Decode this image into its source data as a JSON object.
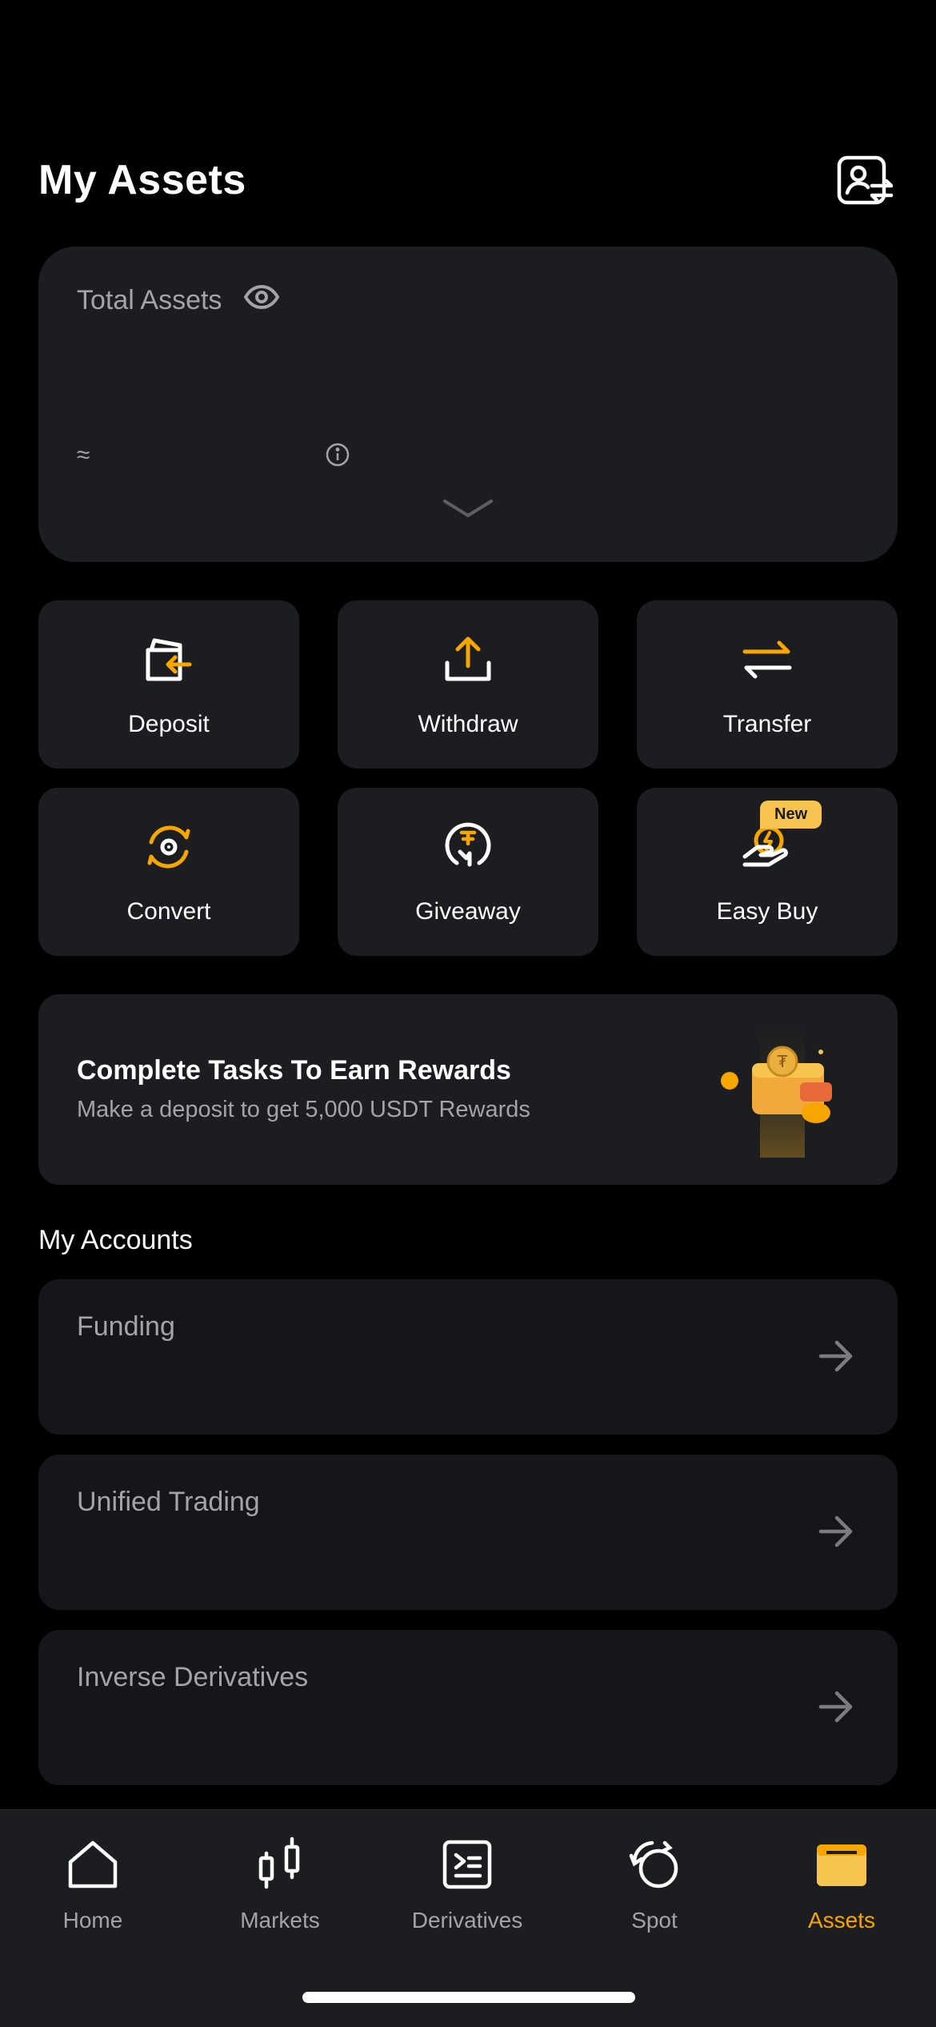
{
  "header": {
    "title": "My Assets",
    "account_switch_icon": "account-switch-icon"
  },
  "total_assets": {
    "label": "Total Assets",
    "visibility_icon": "eye-icon",
    "approx_symbol": "≈",
    "info_icon": "info-icon",
    "expand_icon": "chevron-down-icon"
  },
  "actions": [
    {
      "label": "Deposit",
      "icon": "deposit-icon"
    },
    {
      "label": "Withdraw",
      "icon": "withdraw-icon"
    },
    {
      "label": "Transfer",
      "icon": "transfer-icon"
    },
    {
      "label": "Convert",
      "icon": "convert-icon"
    },
    {
      "label": "Giveaway",
      "icon": "giveaway-icon"
    },
    {
      "label": "Easy Buy",
      "icon": "easy-buy-icon",
      "badge": "New"
    }
  ],
  "promo": {
    "title": "Complete Tasks To Earn Rewards",
    "subtitle": "Make a deposit to get 5,000 USDT Rewards",
    "art_icon": "wallet-rewards-icon"
  },
  "accounts_section": {
    "title": "My Accounts",
    "items": [
      {
        "label": "Funding"
      },
      {
        "label": "Unified Trading"
      },
      {
        "label": "Inverse Derivatives"
      }
    ]
  },
  "tabbar": {
    "active": "Assets",
    "tabs": [
      {
        "label": "Home",
        "icon": "home-icon"
      },
      {
        "label": "Markets",
        "icon": "candlestick-icon"
      },
      {
        "label": "Derivatives",
        "icon": "derivatives-icon"
      },
      {
        "label": "Spot",
        "icon": "spot-icon"
      },
      {
        "label": "Assets",
        "icon": "wallet-icon"
      }
    ]
  },
  "colors": {
    "accent": "#f7a600",
    "card": "#1c1d20",
    "card_dark": "#151619",
    "muted_text": "#a2a4a8",
    "badge": "#f7c450"
  }
}
